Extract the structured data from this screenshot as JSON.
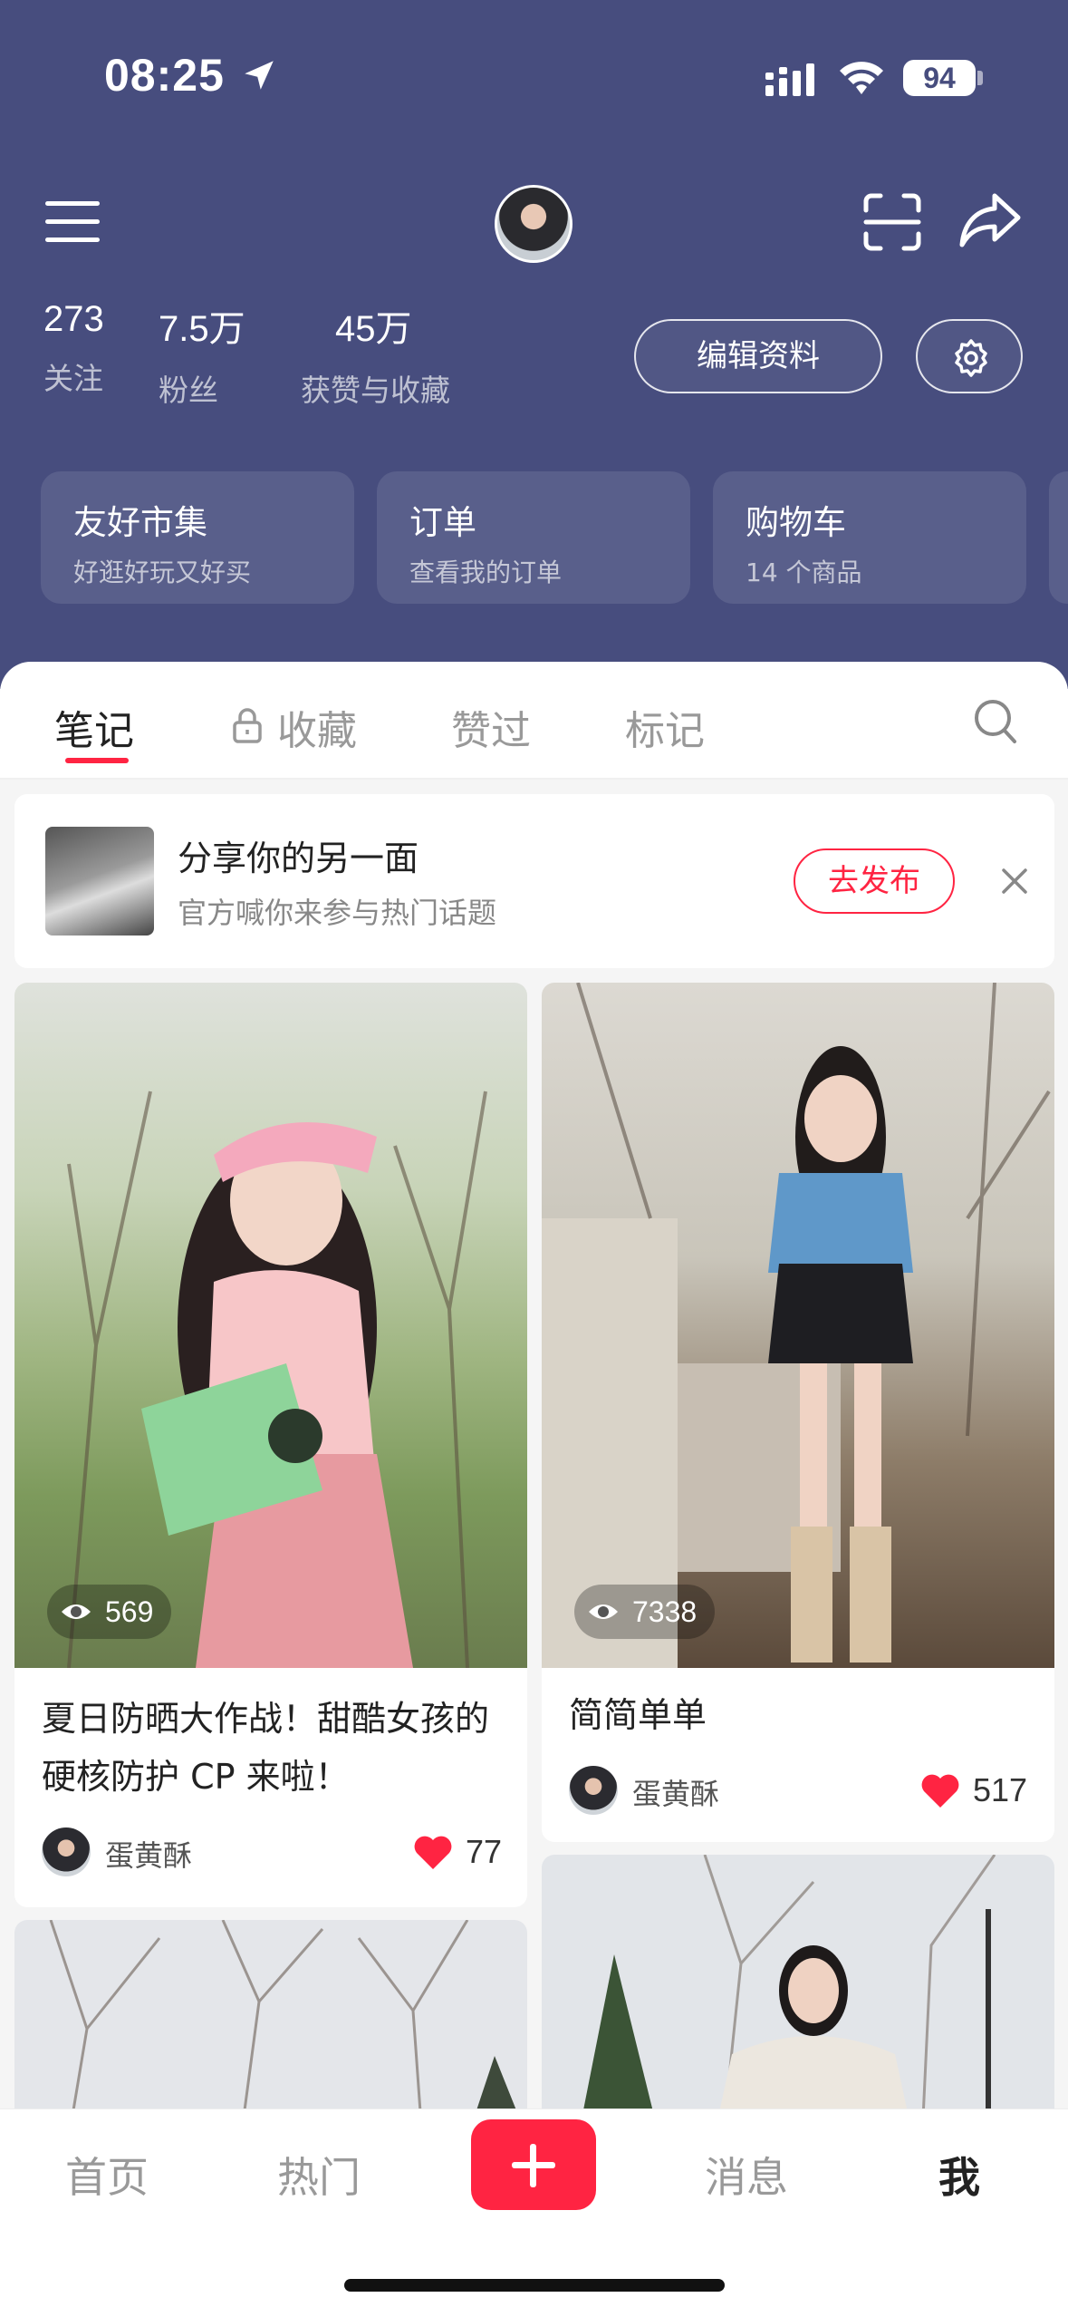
{
  "status_bar": {
    "time": "08:25",
    "battery": "94"
  },
  "profile": {
    "stats": [
      {
        "num": "273",
        "label": "关注"
      },
      {
        "num": "7.5万",
        "label": "粉丝"
      },
      {
        "num": "45万",
        "label": "获赞与收藏"
      }
    ],
    "edit_label": "编辑资料"
  },
  "cards": [
    {
      "title": "友好市集",
      "sub": "好逛好玩又好买"
    },
    {
      "title": "订单",
      "sub": "查看我的订单"
    },
    {
      "title": "购物车",
      "sub": "14 个商品"
    }
  ],
  "tabs": [
    "笔记",
    "收藏",
    "赞过",
    "标记"
  ],
  "promo": {
    "title": "分享你的另一面",
    "sub": "官方喊你来参与热门话题",
    "button": "去发布"
  },
  "notes": [
    {
      "views": "569",
      "title": "夏日防晒大作战！甜酷女孩的硬核防护 CP 来啦！",
      "author": "蛋黄酥",
      "likes": "77"
    },
    {
      "views": "7338",
      "title": "简简单单",
      "author": "蛋黄酥",
      "likes": "517"
    }
  ],
  "bottom_nav": [
    "首页",
    "热门",
    "消息",
    "我"
  ],
  "colors": {
    "header_bg": "#474d7e",
    "accent": "#ff2442"
  }
}
